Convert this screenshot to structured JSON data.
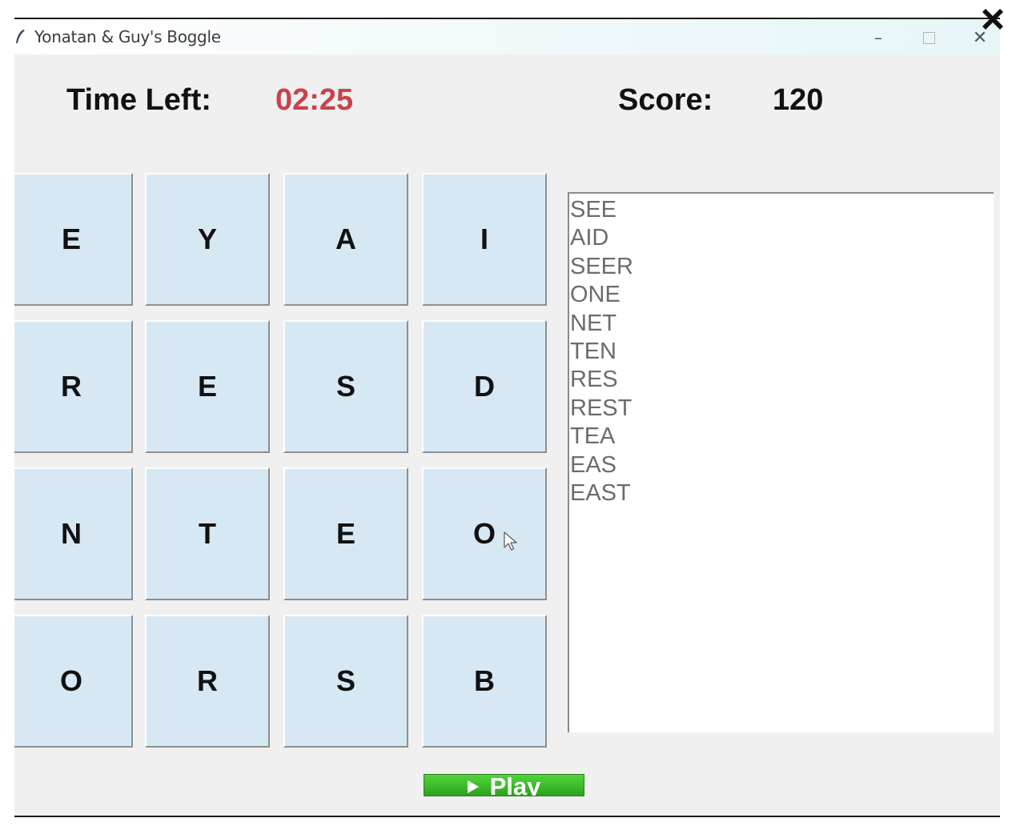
{
  "window": {
    "title": "Yonatan & Guy's Boggle"
  },
  "hud": {
    "time_label": "Time Left:",
    "time_value": "02:25",
    "score_label": "Score:",
    "score_value": "120"
  },
  "board": {
    "rows": [
      [
        "E",
        "Y",
        "A",
        "I"
      ],
      [
        "R",
        "E",
        "S",
        "D"
      ],
      [
        "N",
        "T",
        "E",
        "O"
      ],
      [
        "O",
        "R",
        "S",
        "B"
      ]
    ]
  },
  "found_words": [
    "SEE",
    "AID",
    "SEER",
    "ONE",
    "NET",
    "TEN",
    "RES",
    "REST",
    "TEA",
    "EAS",
    "EAST"
  ],
  "play_button": {
    "label": "Play"
  },
  "colors": {
    "timer": "#c8434a",
    "tile": "#d6e8f4",
    "play": "#3dbb2a"
  }
}
